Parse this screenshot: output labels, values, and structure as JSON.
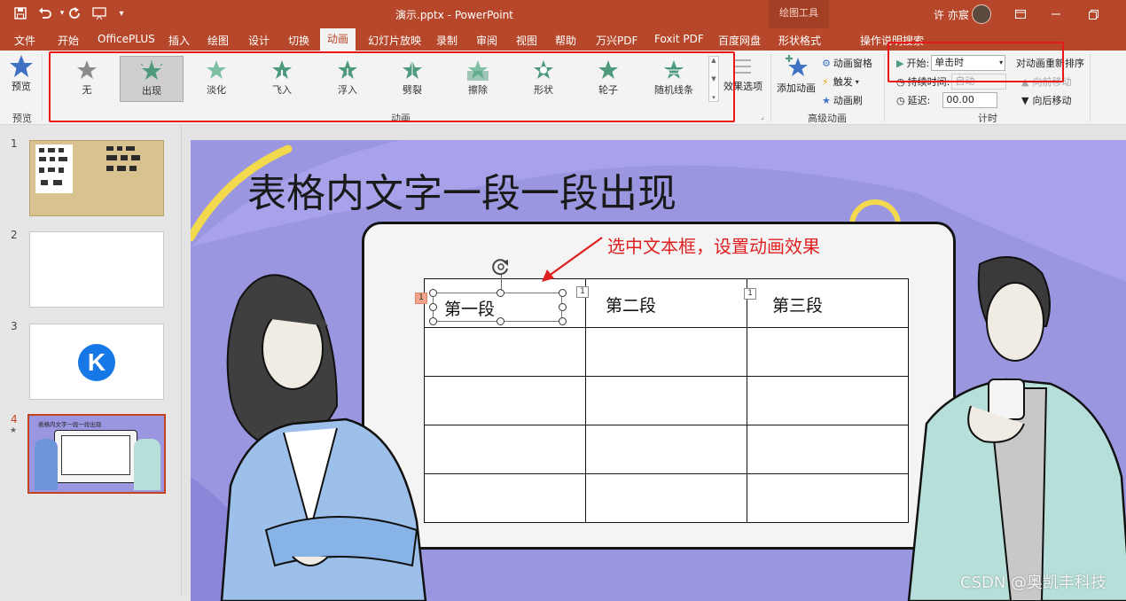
{
  "titlebar": {
    "doc_title": "演示.pptx  -  PowerPoint",
    "context_tab_group": "绘图工具",
    "user_name": "许 亦宸",
    "quick_access": [
      "save-icon",
      "undo-icon",
      "redo-icon",
      "slideshow-icon",
      "customize-icon"
    ]
  },
  "tabs": [
    "文件",
    "开始",
    "OfficePLUS",
    "插入",
    "绘图",
    "设计",
    "切换",
    "动画",
    "幻灯片放映",
    "录制",
    "审阅",
    "视图",
    "帮助",
    "万兴PDF",
    "Foxit PDF",
    "百度网盘",
    "形状格式"
  ],
  "active_tab": "动画",
  "tell_me": "操作说明搜索",
  "ribbon": {
    "preview": {
      "button": "预览",
      "group": "预览"
    },
    "animation_gallery": {
      "items": [
        "无",
        "出现",
        "淡化",
        "飞入",
        "浮入",
        "劈裂",
        "擦除",
        "形状",
        "轮子",
        "随机线条"
      ],
      "selected": "出现",
      "group": "动画"
    },
    "effect_options": "效果选项",
    "advanced": {
      "add": "添加动画",
      "pane": "动画窗格",
      "trigger": "触发",
      "painter": "动画刷",
      "group": "高级动画"
    },
    "timing": {
      "start_label": "开始:",
      "start_value": "单击时",
      "duration_label": "持续时间:",
      "duration_value": "自动",
      "delay_label": "延迟:",
      "delay_value": "00.00",
      "reorder": "对动画重新排序",
      "move_earlier": "向前移动",
      "move_later": "向后移动",
      "group": "计时"
    }
  },
  "thumbnails": [
    {
      "number": "1"
    },
    {
      "number": "2"
    },
    {
      "number": "3",
      "logo": "K"
    },
    {
      "number": "4",
      "star": "★",
      "mini_title": "表格内文字一段一段出现"
    }
  ],
  "slide": {
    "title": "表格内文字一段一段出现",
    "callout": "选中文本框，设置动画效果",
    "cells": [
      "第一段",
      "第二段",
      "第三段"
    ],
    "markers": [
      "1",
      "1",
      "1"
    ]
  },
  "watermark": "CSDN @奥凯丰科技",
  "colors": {
    "accent": "#b7472a",
    "highlight": "#e81818",
    "slide_bg": "#9b96e0",
    "star": "#4e9a7c"
  }
}
